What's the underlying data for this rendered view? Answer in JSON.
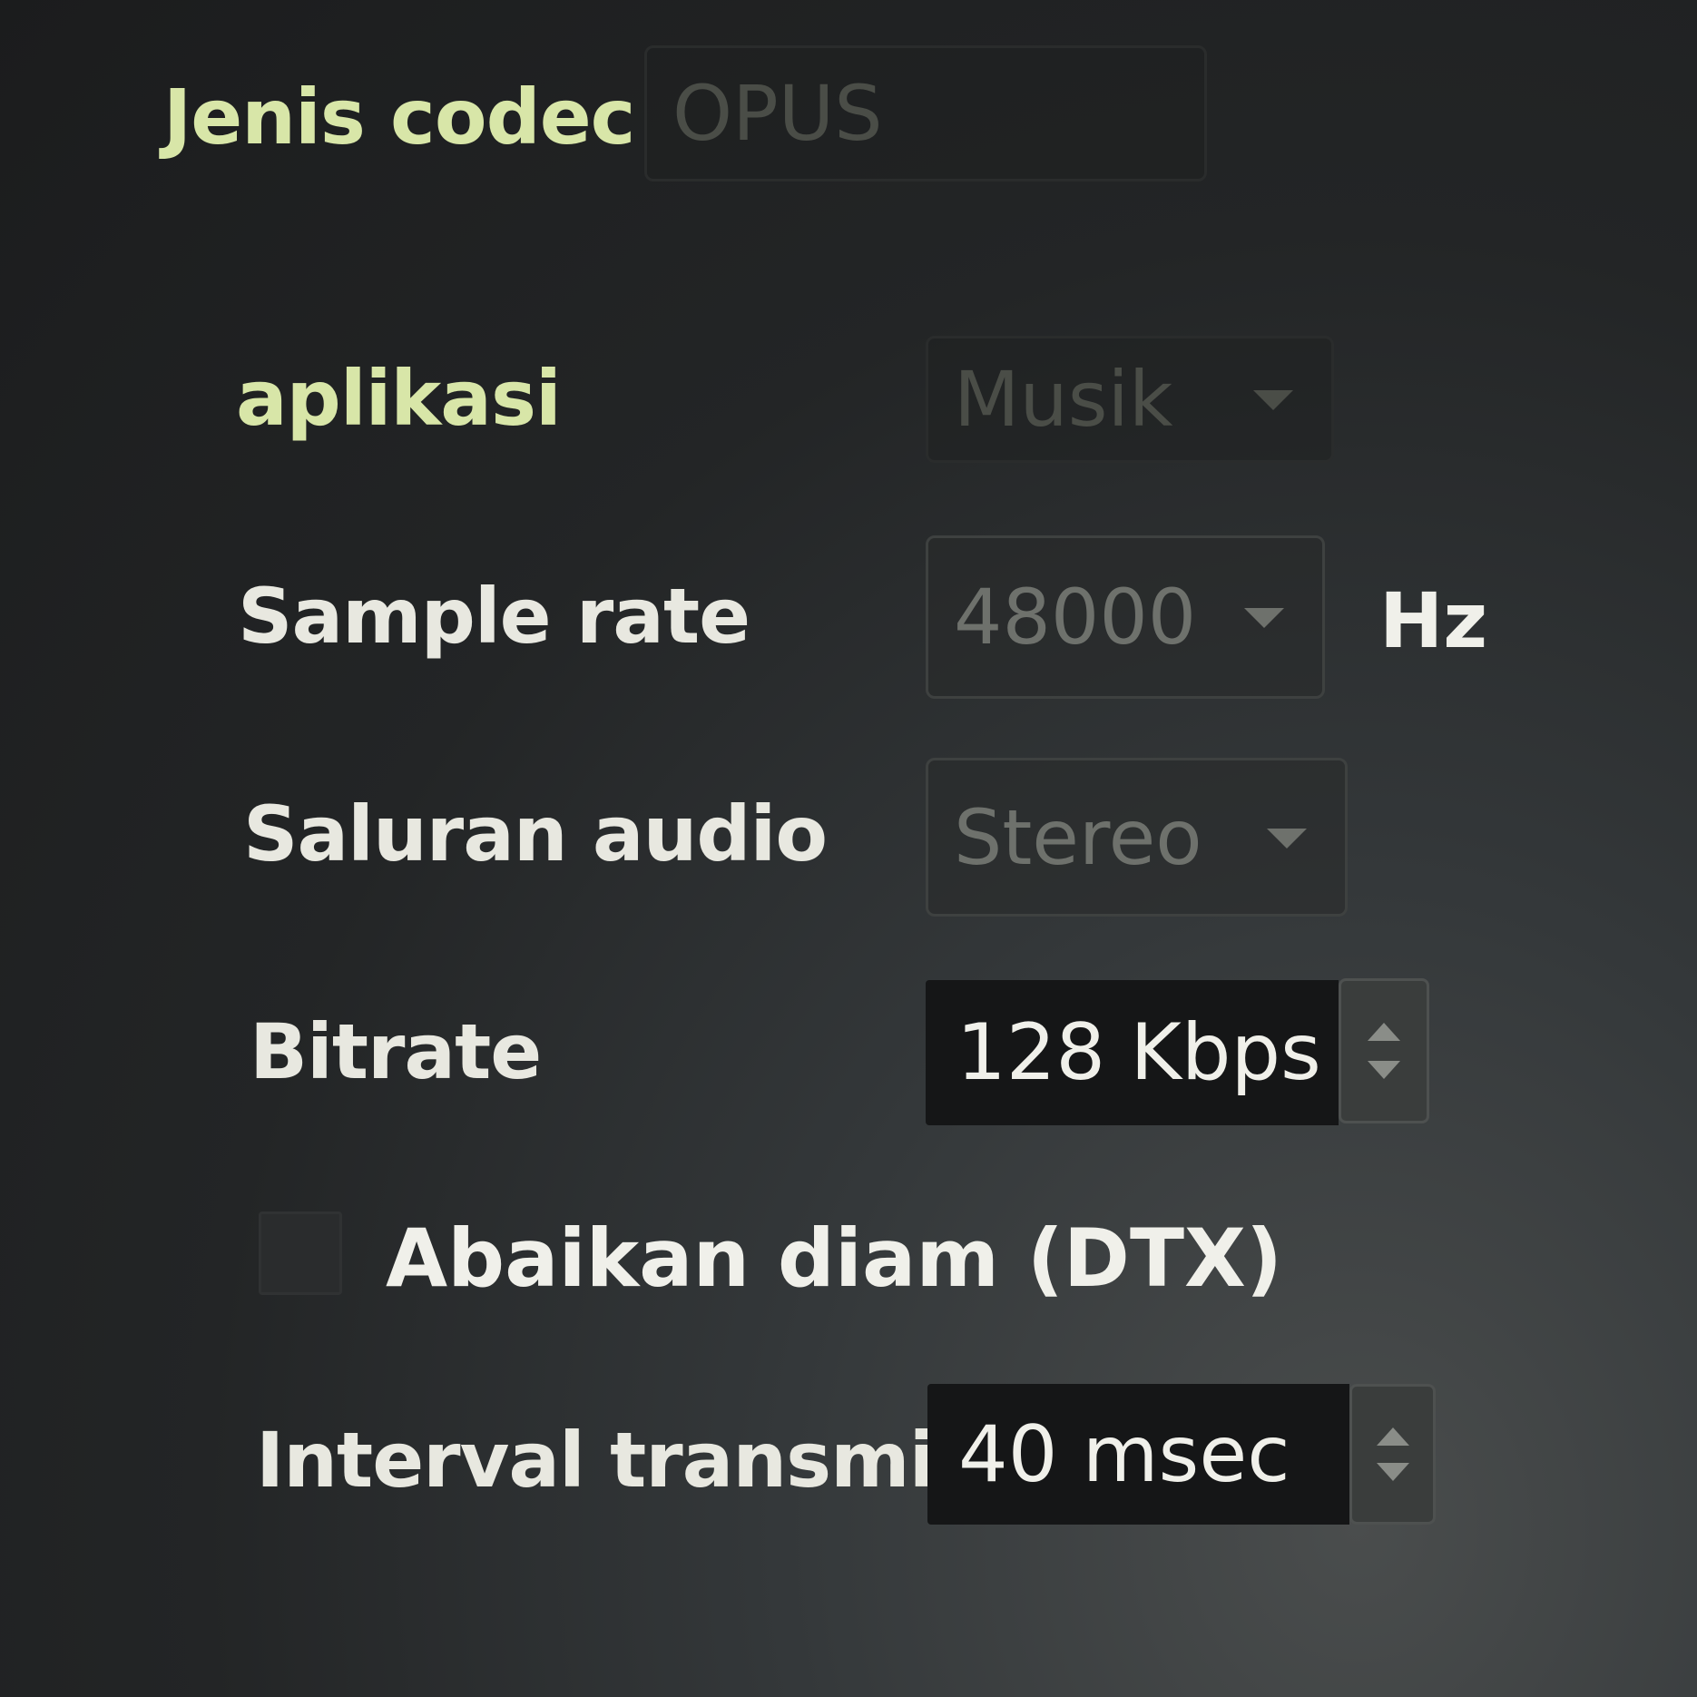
{
  "codec": {
    "label": "Jenis codec",
    "value": "OPUS"
  },
  "application": {
    "label": "aplikasi",
    "value": "Musik"
  },
  "sample_rate": {
    "label": "Sample rate",
    "value": "48000",
    "unit": "Hz"
  },
  "audio_channel": {
    "label": "Saluran audio",
    "value": "Stereo"
  },
  "bitrate": {
    "label": "Bitrate",
    "value": "128 Kbps"
  },
  "dtx": {
    "label": "Abaikan diam (DTX)",
    "checked": false
  },
  "transmit_interval": {
    "label": "Interval transmisi",
    "value": "40 msec"
  },
  "colors": {
    "label_accent": "#d8e6a8",
    "label_text": "#e8e8e0",
    "field_bg": "#151617",
    "disabled_text": "#6e716c"
  }
}
